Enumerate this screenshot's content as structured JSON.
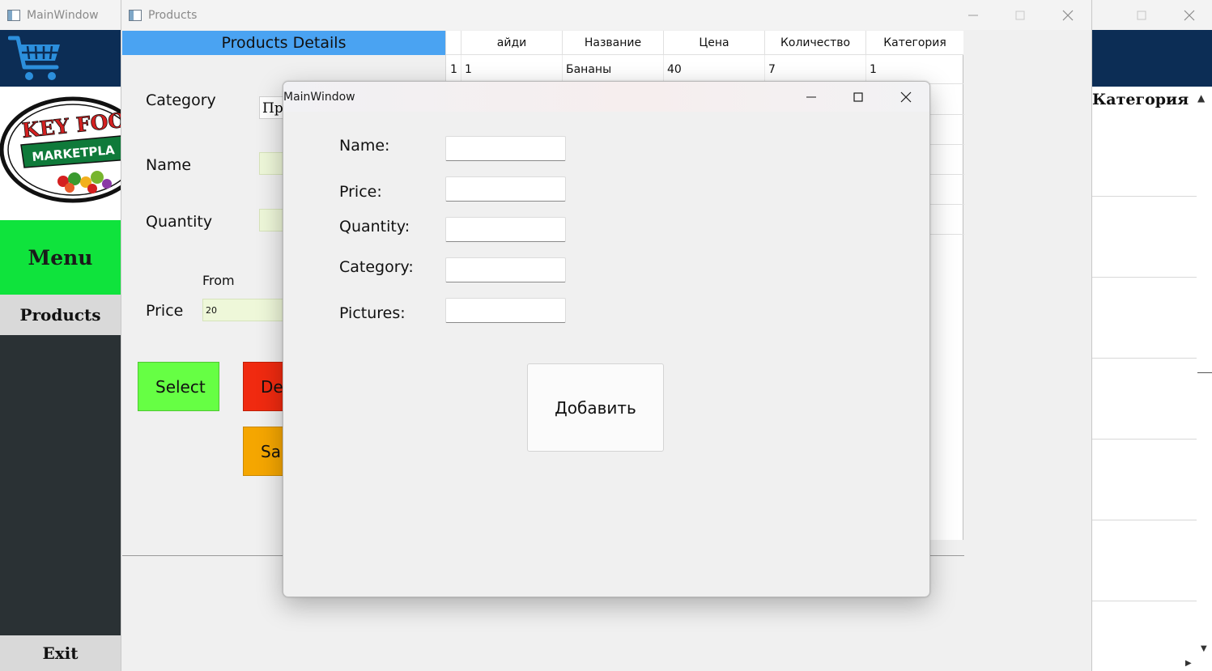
{
  "background_window": {
    "title": "MainWindow",
    "menu_label": "Menu",
    "products_label": "Products",
    "exit_label": "Exit",
    "logo_text_top": "KEY FOO",
    "logo_text_bottom": "MARKETPLA",
    "right_column_header": "Категория",
    "colors": {
      "header": "#0c2d55",
      "menu": "#0fe33c",
      "sidebar": "#2a3134"
    },
    "icons": [
      "shopping-cart-icon",
      "minimize-icon",
      "maximize-icon",
      "close-icon"
    ]
  },
  "products_window": {
    "title": "Products",
    "header": "Products Details",
    "labels": {
      "category": "Category",
      "name": "Name",
      "quantity": "Quantity",
      "price": "Price",
      "from": "From"
    },
    "category_value": "Про",
    "price_from_value": "20",
    "buttons": {
      "select": "Select",
      "delete": "Del",
      "save": "Sa"
    },
    "button_colors": {
      "select": "#66ff44",
      "delete": "#f02a10",
      "save": "#f5a600"
    },
    "table": {
      "columns": [
        "айди",
        "Название",
        "Цена",
        "Количество",
        "Категория"
      ],
      "rows": [
        {
          "index": "1",
          "cells": [
            "1",
            "Бананы",
            "40",
            "7",
            "1"
          ]
        }
      ]
    }
  },
  "dialog": {
    "title": "MainWindow",
    "labels": {
      "name": "Name:",
      "price": "Price:",
      "quantity": "Quantity:",
      "category": "Category:",
      "pictures": "Pictures:"
    },
    "values": {
      "name": "",
      "price": "",
      "quantity": "",
      "category": "",
      "pictures": ""
    },
    "add_button": "Добавить"
  }
}
